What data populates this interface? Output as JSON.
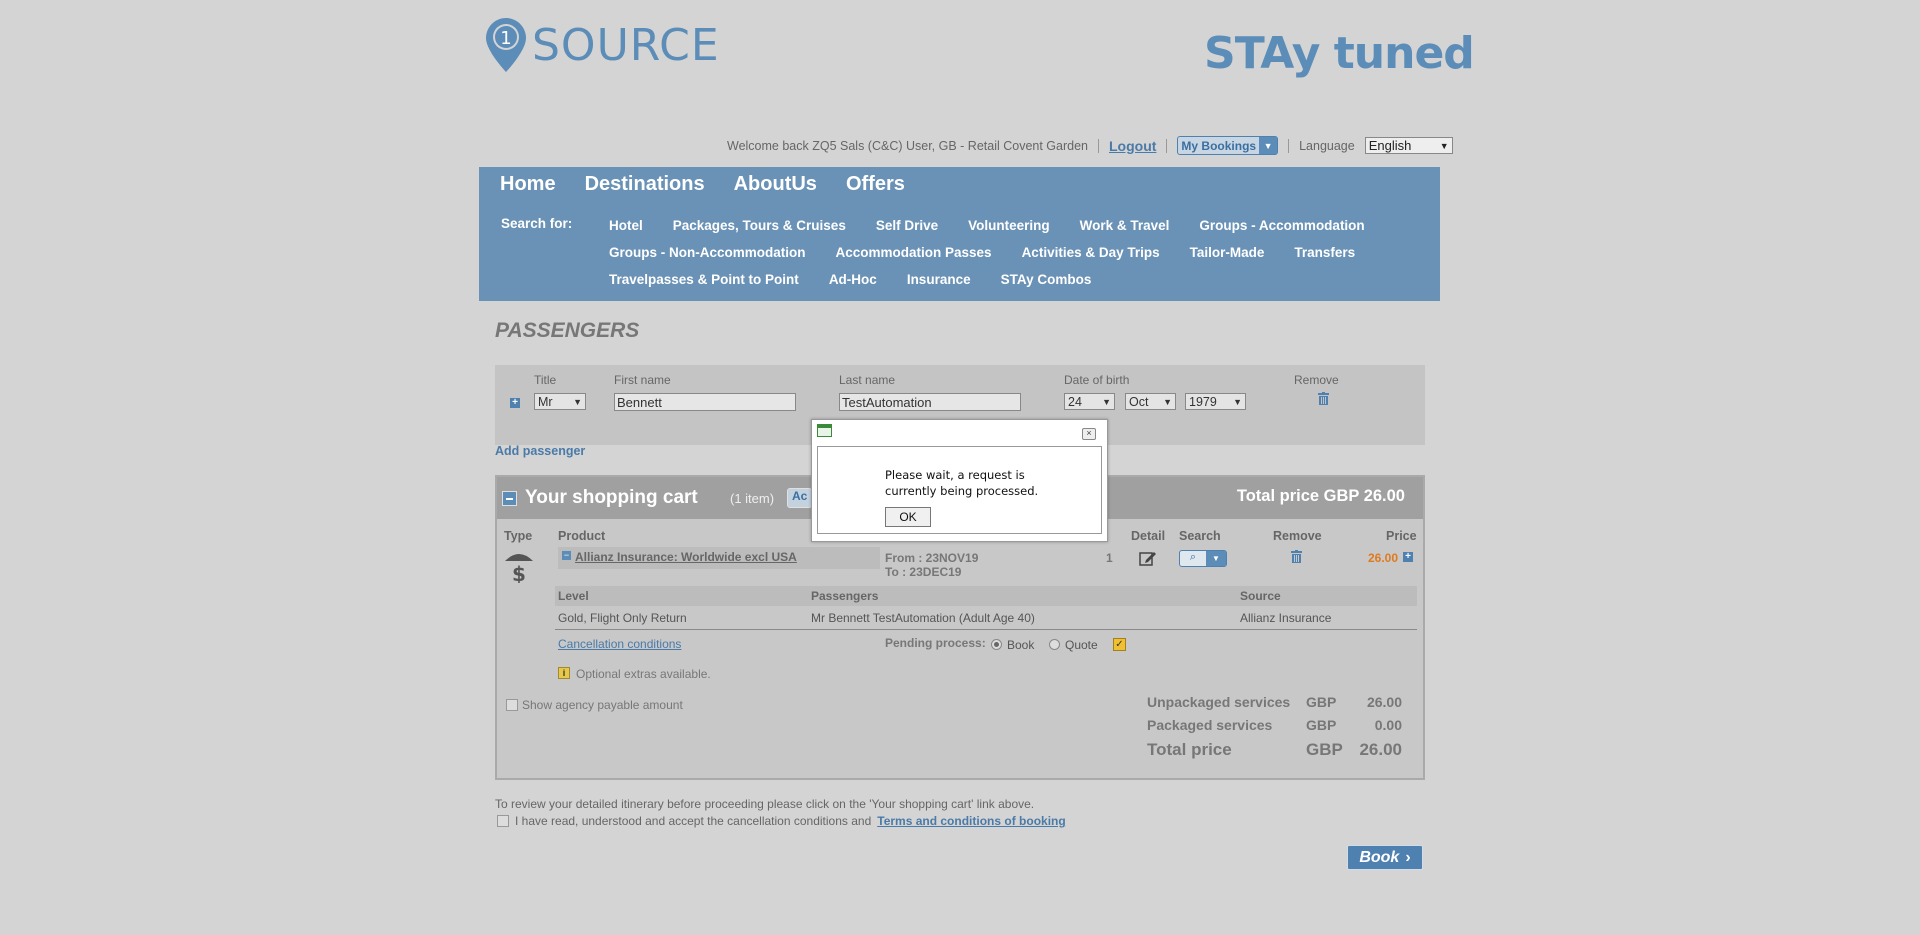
{
  "header": {
    "logo_left": "SOURCE",
    "logo_left_prefix": "1",
    "logo_right": "STAy tuned",
    "welcome": "Welcome back ZQ5 Sals (C&C) User, GB - Retail Covent Garden",
    "logout": "Logout",
    "my_bookings": "My Bookings",
    "language_label": "Language",
    "language_value": "English"
  },
  "nav": {
    "main": [
      "Home",
      "Destinations",
      "AboutUs",
      "Offers"
    ],
    "search_for": "Search for:",
    "rows": [
      [
        "Hotel",
        "Packages, Tours & Cruises",
        "Self Drive",
        "Volunteering",
        "Work & Travel",
        "Groups - Accommodation"
      ],
      [
        "Groups - Non-Accommodation",
        "Accommodation Passes",
        "Activities & Day Trips",
        "Tailor-Made",
        "Transfers"
      ],
      [
        "Travelpasses & Point to Point",
        "Ad-Hoc",
        "Insurance",
        "STAy Combos"
      ]
    ]
  },
  "passengers": {
    "title": "PASSENGERS",
    "labels": {
      "title": "Title",
      "first": "First name",
      "last": "Last name",
      "dob": "Date of birth",
      "remove": "Remove"
    },
    "row": {
      "title": "Mr",
      "first": "Bennett",
      "last": "TestAutomation",
      "day": "24",
      "month": "Oct",
      "year": "1979"
    },
    "add": "Add passenger"
  },
  "cart": {
    "title": "Your shopping cart",
    "count": "(1 item)",
    "action": "Ac",
    "total_label": "Total price",
    "total_value": "GBP 26.00",
    "columns": {
      "type": "Type",
      "product": "Product",
      "detail": "Detail",
      "search": "Search",
      "remove": "Remove",
      "price": "Price"
    },
    "item": {
      "product": "Allianz Insurance: Worldwide excl USA",
      "from": "From : 23NOV19",
      "to": "To : 23DEC19",
      "qty": "1",
      "price": "26.00",
      "sub_headers": {
        "level": "Level",
        "passengers": "Passengers",
        "source": "Source"
      },
      "level": "Gold, Flight Only Return",
      "passengers": "Mr Bennett TestAutomation (Adult Age 40)",
      "source": "Allianz Insurance",
      "cancellation": "Cancellation conditions",
      "pending_label": "Pending process:",
      "book": "Book",
      "quote": "Quote",
      "extras": "Optional extras available."
    },
    "show_agency": "Show agency payable amount",
    "summary": [
      {
        "label": "Unpackaged services",
        "cur": "GBP",
        "val": "26.00"
      },
      {
        "label": "Packaged services",
        "cur": "GBP",
        "val": "0.00"
      },
      {
        "label": "Total price",
        "cur": "GBP",
        "val": "26.00"
      }
    ]
  },
  "footer": {
    "note": "To review your detailed itinerary before proceeding please click on the 'Your shopping cart' link above.",
    "accept": "I have read, understood and accept the cancellation conditions and",
    "terms": "Terms and conditions of booking",
    "book": "Book"
  },
  "dialog": {
    "message": "Please wait, a request is currently being processed.",
    "ok": "OK"
  },
  "colors": {
    "accent": "#5b8db8",
    "nav": "#6a92b6",
    "price": "#e07a1f"
  }
}
